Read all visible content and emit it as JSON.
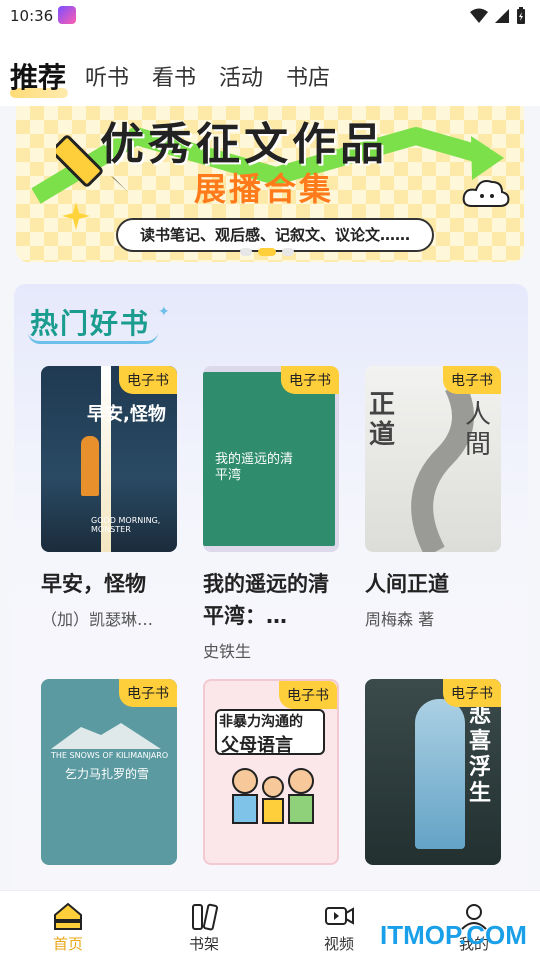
{
  "status_bar": {
    "time": "10:36"
  },
  "tabs": [
    {
      "label": "推荐",
      "active": true
    },
    {
      "label": "听书"
    },
    {
      "label": "看书"
    },
    {
      "label": "活动"
    },
    {
      "label": "书店"
    }
  ],
  "banner": {
    "title": "优秀征文作品",
    "subtitle": "展播合集",
    "pill": "读书笔记、观后感、记叙文、议论文……"
  },
  "hot_books": {
    "title": "热门好书",
    "badge": "电子书",
    "books": [
      {
        "title": "早安，怪物",
        "author": "（加）凯瑟琳…",
        "cover_text": "早安,怪物",
        "cover_sub": "GOOD MORNING, MONSTER"
      },
      {
        "title": "我的遥远的清平湾：…",
        "author": "史铁生",
        "cover_text": "我的遥远的清平湾"
      },
      {
        "title": "人间正道",
        "author": "周梅森 著",
        "cover_text": "正道",
        "cover_text2": "人間"
      },
      {
        "title": "乞力马扎罗",
        "author": "",
        "cover_text": "乞力马扎罗的雪",
        "cover_sub": "THE SNOWS OF KILIMANJARO"
      },
      {
        "title": "非暴力沟通",
        "author": "",
        "cover_text": "非暴力沟通的",
        "cover_text2": "父母语言"
      },
      {
        "title": "悲喜浮生",
        "author": "",
        "cover_text": "悲喜浮生"
      }
    ]
  },
  "bottom_nav": [
    {
      "label": "首页",
      "active": true
    },
    {
      "label": "书架"
    },
    {
      "label": "视频"
    },
    {
      "label": "我的"
    }
  ],
  "watermark": "ITMOP.COM",
  "colors": {
    "accent": "#ffcf3b",
    "nav_active": "#e8a81a",
    "hot_title": "#1a9c8e"
  }
}
